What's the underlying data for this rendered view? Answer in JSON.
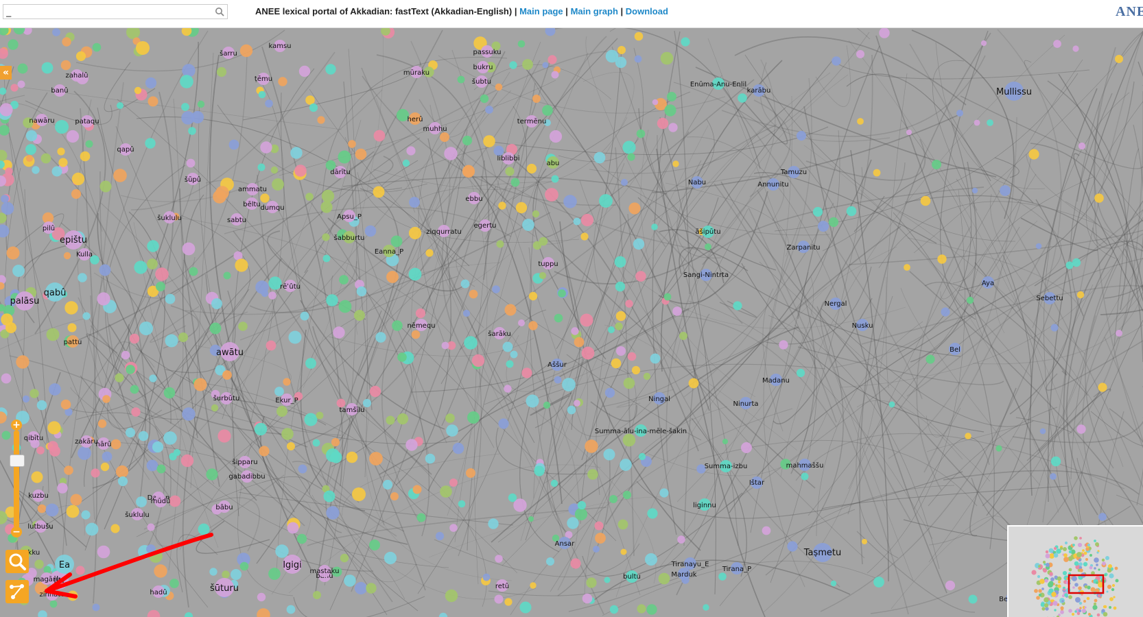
{
  "header": {
    "search_value": "_",
    "title": "ANEE lexical portal of Akkadian: fastText (Akkadian-English)",
    "separator": "|",
    "links": [
      "Main page",
      "Main graph",
      "Download"
    ],
    "logo_text": "ANEE"
  },
  "controls": {
    "collapse_label": "«",
    "zoom_in_label": "+",
    "zoom_out_label": "−",
    "zoom_level": 0.72
  },
  "colors": {
    "accent": "#f5a623",
    "link": "#1e88c8",
    "edges": "#505050",
    "graph_background": "#a4a4a4",
    "annotation_arrow": "#ff0000",
    "minimap_viewport": "#dd0000",
    "node_palette": [
      "#7fd0dc",
      "#d4a3da",
      "#a3c66b",
      "#f0a45d",
      "#f5c842",
      "#5ed9c5",
      "#e98aa4",
      "#8a9ed8",
      "#66cc88"
    ]
  },
  "icons": {
    "search_field": "magnifier-icon",
    "search_tool": "search-icon",
    "path_tool": "path-icon"
  },
  "nodes": [
    {
      "label": "qibītu",
      "cls": 1
    },
    {
      "label": "šurbūtu",
      "cls": 1
    },
    {
      "label": "Dagan",
      "cls": 1
    },
    {
      "label": "rēʾûtu",
      "cls": 1
    },
    {
      "label": "ilu",
      "cls": 1
    },
    {
      "label": "mūdû",
      "cls": 1
    },
    {
      "label": "Igigi",
      "cls": 1
    },
    {
      "label": "šūturu",
      "cls": 1
    },
    {
      "label": "nēmequ",
      "cls": 1
    },
    {
      "label": "epištu",
      "cls": 1
    },
    {
      "label": "awātu",
      "cls": 1
    },
    {
      "label": "šarāku",
      "cls": 1
    },
    {
      "label": "palāsu",
      "cls": 1
    },
    {
      "label": "dumqu",
      "cls": 1
    },
    {
      "label": "magāru",
      "cls": 1
    },
    {
      "label": "zinnātu",
      "cls": 1
    },
    {
      "label": "bēltu",
      "cls": 1
    },
    {
      "label": "zakāru",
      "cls": 1
    },
    {
      "label": "qabû",
      "cls": 0
    },
    {
      "label": "Eanna_P",
      "cls": 2
    },
    {
      "label": "dārītu",
      "cls": 1
    },
    {
      "label": "parakku",
      "cls": 2
    },
    {
      "label": "šarru",
      "cls": 1
    },
    {
      "label": "bānû",
      "cls": 1
    },
    {
      "label": "abu",
      "cls": 2
    },
    {
      "label": "ṭēmu",
      "cls": 1
    },
    {
      "label": "Ea",
      "cls": 0
    },
    {
      "label": "Apsu_P",
      "cls": 1
    },
    {
      "label": "hadû",
      "cls": 1
    },
    {
      "label": "nawāru",
      "cls": 1
    },
    {
      "label": "pattu",
      "cls": 3
    },
    {
      "label": "herû",
      "cls": 3
    },
    {
      "label": "sabtu",
      "cls": 1
    },
    {
      "label": "gabadibbu",
      "cls": 1
    },
    {
      "label": "šuklulu",
      "cls": 1
    },
    {
      "label": "ziqqurratu",
      "cls": 1
    },
    {
      "label": "termēnu",
      "cls": 1
    },
    {
      "label": "Kulla",
      "cls": 1
    },
    {
      "label": "nārū",
      "cls": 1
    },
    {
      "label": "šubtu",
      "cls": 1
    },
    {
      "label": "qapû",
      "cls": 1
    },
    {
      "label": "banû",
      "cls": 1
    },
    {
      "label": "pilû",
      "cls": 1
    },
    {
      "label": "šūpû",
      "cls": 1
    },
    {
      "label": "šabburtu",
      "cls": 2
    },
    {
      "label": "muhhu",
      "cls": 1
    },
    {
      "label": "egertu",
      "cls": 1
    },
    {
      "label": "kamsu",
      "cls": 1
    },
    {
      "label": "Aššur",
      "cls": 7
    },
    {
      "label": "Marduk",
      "cls": 7
    },
    {
      "label": "karābu",
      "cls": 7
    },
    {
      "label": "Zarpanitu",
      "cls": 7
    },
    {
      "label": "Nabu",
      "cls": 7
    },
    {
      "label": "Bel",
      "cls": 7
    },
    {
      "label": "Taṣmetu",
      "cls": 7
    },
    {
      "label": "Ištar",
      "cls": 7
    },
    {
      "label": "Mullissu",
      "cls": 7
    },
    {
      "label": "Ningal",
      "cls": 7
    },
    {
      "label": "Nergal",
      "cls": 7
    },
    {
      "label": "Ninurta",
      "cls": 7
    },
    {
      "label": "Nusku",
      "cls": 7
    },
    {
      "label": "Annunitu",
      "cls": 7
    },
    {
      "label": "Sebettu",
      "cls": 7
    },
    {
      "label": "Madanu",
      "cls": 7
    },
    {
      "label": "Belet-ili",
      "cls": 7
    },
    {
      "label": "Aya",
      "cls": 7
    },
    {
      "label": "Tamuzu",
      "cls": 7
    },
    {
      "label": "Tirana_P",
      "cls": 7
    },
    {
      "label": "Tiranayu_E",
      "cls": 7
    },
    {
      "label": "Sangi-Nintrta",
      "cls": 7
    },
    {
      "label": "mahmaššu",
      "cls": 7
    },
    {
      "label": "tuppu",
      "cls": 1
    },
    {
      "label": "bukru",
      "cls": 1
    },
    {
      "label": "liblibbi",
      "cls": 1
    },
    {
      "label": "Ansar",
      "cls": 7
    },
    {
      "label": "ammatu",
      "cls": 1
    },
    {
      "label": "mūraku",
      "cls": 1
    },
    {
      "label": "passuku",
      "cls": 1
    },
    {
      "label": "Enūma-Anu-Enlil",
      "cls": 5
    },
    {
      "label": "Summa-izbu",
      "cls": 5
    },
    {
      "label": "Summa-ālu-ina-mēle-šakin",
      "cls": 5
    },
    {
      "label": "liginnu",
      "cls": 5
    },
    {
      "label": "āšipūtu",
      "cls": 5
    },
    {
      "label": "bultu",
      "cls": 5
    },
    {
      "label": "ebbu",
      "cls": 1
    },
    {
      "label": "pataqu",
      "cls": 1
    },
    {
      "label": "bābu",
      "cls": 1
    },
    {
      "label": "zahalû",
      "cls": 1
    },
    {
      "label": "kuzbu",
      "cls": 1
    },
    {
      "label": "lutbušu",
      "cls": 1
    },
    {
      "label": "mastaku",
      "cls": 1
    },
    {
      "label": "tamšīlu",
      "cls": 1
    },
    {
      "label": "retû",
      "cls": 1
    },
    {
      "label": "šipparu",
      "cls": 1
    },
    {
      "label": "Ekur_P",
      "cls": 1
    },
    {
      "label": "šuklulu",
      "cls": 1
    }
  ]
}
